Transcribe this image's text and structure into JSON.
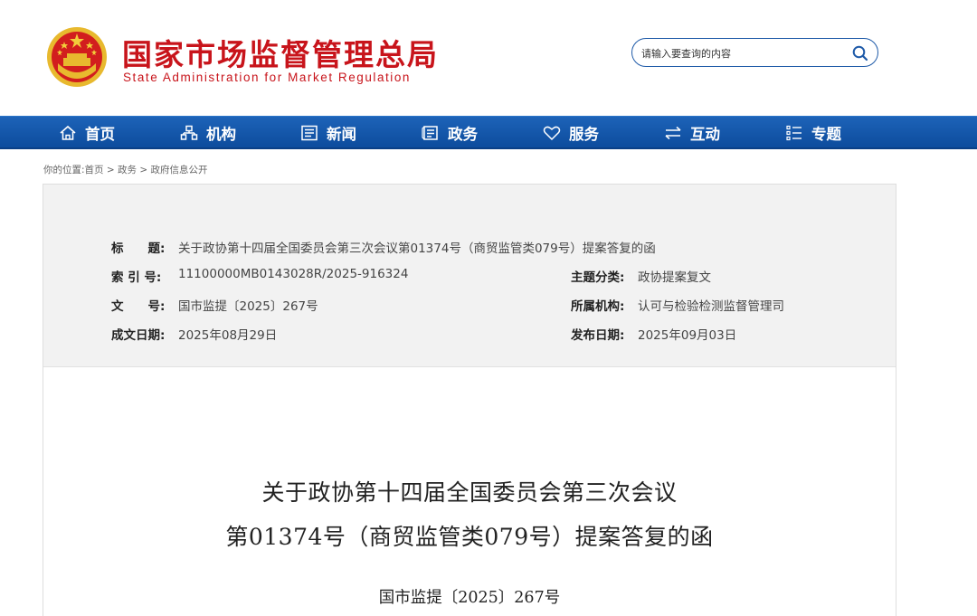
{
  "header": {
    "brand_cn": "国家市场监督管理总局",
    "brand_en": "State Administration for Market Regulation",
    "search_placeholder": "请输入要查询的内容",
    "search_icon": "search-icon",
    "brand_color": "#c8141b"
  },
  "nav": {
    "items": [
      {
        "label": "首页",
        "icon": "home-icon"
      },
      {
        "label": "机构",
        "icon": "org-chart-icon"
      },
      {
        "label": "新闻",
        "icon": "newspaper-icon"
      },
      {
        "label": "政务",
        "icon": "government-icon"
      },
      {
        "label": "服务",
        "icon": "heart-icon"
      },
      {
        "label": "互动",
        "icon": "exchange-arrows-icon"
      },
      {
        "label": "专题",
        "icon": "list-icon"
      }
    ],
    "bg_color": "#1560b0"
  },
  "breadcrumb": {
    "prefix": "你的位置:",
    "items": [
      "首页",
      "政务",
      "政府信息公开"
    ],
    "separator": " > "
  },
  "meta": {
    "title_label": "标　　题:",
    "title_value": "关于政协第十四届全国委员会第三次会议第01374号（商贸监管类079号）提案答复的函",
    "index_label": "索 引 号:",
    "index_value": "11100000MB0143028R/2025-916324",
    "category_label": "主题分类:",
    "category_value": "政协提案复文",
    "docno_label": "文　　号:",
    "docno_value": "国市监提〔2025〕267号",
    "agency_label": "所属机构:",
    "agency_value": "认可与检验检测监督管理司",
    "written_label": "成文日期:",
    "written_value": "2025年08月29日",
    "published_label": "发布日期:",
    "published_value": "2025年09月03日"
  },
  "document": {
    "title_line1": "关于政协第十四届全国委员会第三次会议",
    "title_line2": "第01374号（商贸监管类079号）提案答复的函",
    "number": "国市监提〔2025〕267号"
  }
}
